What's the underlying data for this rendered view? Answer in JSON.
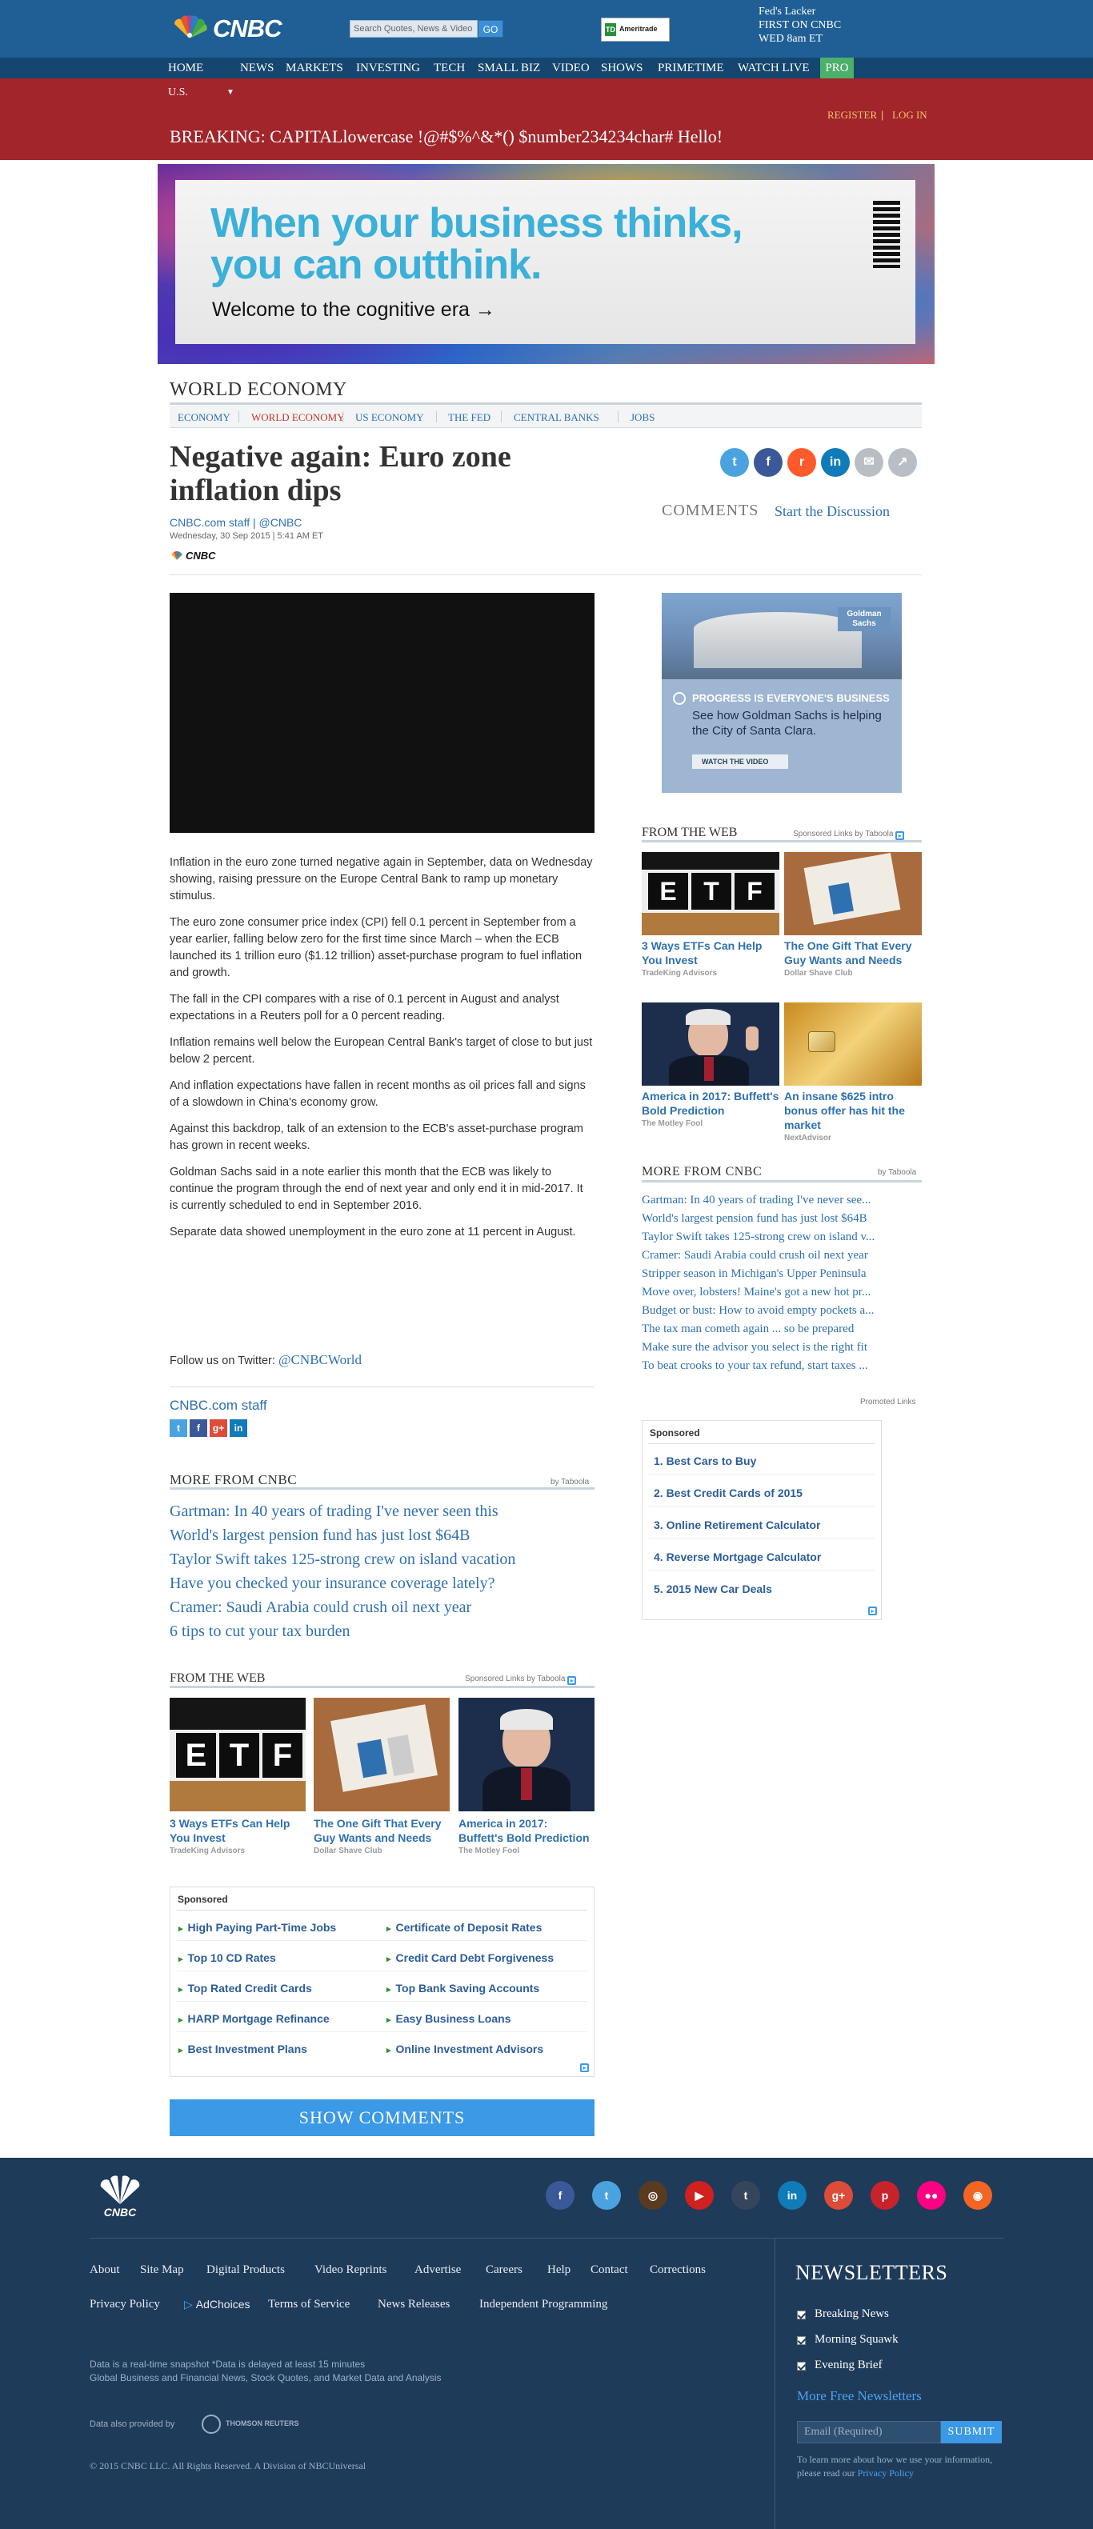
{
  "header": {
    "logo_text": "CNBC",
    "search_placeholder": "Search Quotes, News & Video",
    "search_button": "GO",
    "sponsor_logo": "Ameritrade",
    "promo_lines": [
      "Fed's Lacker",
      "FIRST ON CNBC",
      "WED 8am ET"
    ]
  },
  "nav": {
    "items": [
      "HOME",
      "NEWS",
      "MARKETS",
      "INVESTING",
      "TECH",
      "SMALL BIZ",
      "VIDEO",
      "SHOWS",
      "PRIMETIME",
      "WATCH LIVE"
    ],
    "pro": "PRO"
  },
  "region": {
    "label": "U.S.",
    "register": "REGISTER",
    "login": "LOG IN",
    "separator": "|",
    "breaking": "BREAKING:  CAPITALlowercase !@#$%^&*() $number234234char# Hello!"
  },
  "ad_banner": {
    "headline_1": "When your business thinks,",
    "headline_2": "you can outthink.",
    "subline": "Welcome to the cognitive era →",
    "brand": "IBM"
  },
  "section": {
    "title": "WORLD ECONOMY",
    "tabs": [
      "ECONOMY",
      "WORLD ECONOMY",
      "US ECONOMY",
      "THE FED",
      "CENTRAL BANKS",
      "JOBS"
    ],
    "active_tab": "WORLD ECONOMY"
  },
  "article": {
    "headline": "Negative again: Euro zone inflation dips",
    "byline": "CNBC.com staff | @CNBC",
    "dateline": "Wednesday, 30 Sep 2015 | 5:41 AM ET",
    "source_logo": "CNBC",
    "comments_label": "COMMENTS",
    "comments_link": "Start the Discussion",
    "paragraphs": [
      "Inflation in the euro zone turned negative again in September, data on Wednesday showing, raising pressure on the Europe Central Bank to ramp up monetary stimulus.",
      "The euro zone consumer price index (CPI) fell 0.1 percent in September from a year earlier, falling below zero for the first time since March – when the ECB launched its 1 trillion euro ($1.12 trillion) asset-purchase program to fuel inflation and growth.",
      "The fall in the CPI compares with a rise of 0.1 percent in August and analyst expectations in a Reuters poll for a 0 percent reading.",
      "Inflation remains well below the European Central Bank's target of close to but just below 2 percent.",
      "And inflation expectations have fallen in recent months as oil prices fall and signs of a slowdown in China's economy grow.",
      "Against this backdrop, talk of an extension to the ECB's asset-purchase program has grown in recent weeks.",
      "Goldman Sachs said in a note earlier this month that the ECB was likely to continue the program through the end of next year and only end it in mid-2017. It is currently scheduled to end in September 2016.",
      "Separate data showed unemployment in the euro zone at 11 percent in August."
    ],
    "follow_prefix": "Follow us on Twitter: ",
    "follow_handle": "@CNBCWorld",
    "author": "CNBC.com staff"
  },
  "share_icons": [
    "twitter-icon",
    "facebook-icon",
    "reddit-icon",
    "linkedin-icon",
    "email-icon",
    "share-icon"
  ],
  "more_from_cnbc": {
    "title": "MORE FROM CNBC",
    "by": "by Taboola",
    "items": [
      "Gartman: In 40 years of trading I've never seen this",
      "World's largest pension fund has just lost $64B",
      "Taylor Swift takes 125-strong crew on island vacation",
      "Have you checked your insurance coverage lately?",
      "Cramer: Saudi Arabia could crush oil next year",
      "6 tips to cut your tax burden"
    ]
  },
  "from_the_web": {
    "title": "FROM THE WEB",
    "sponsored": "Sponsored Links by Taboola",
    "cards": [
      {
        "title": "3 Ways ETFs Can Help You Invest",
        "source": "TradeKing Advisors"
      },
      {
        "title": "The One Gift That Every Guy Wants and Needs",
        "source": "Dollar Shave Club"
      },
      {
        "title": "America in 2017: Buffett's Bold Prediction",
        "source": "The Motley Fool"
      }
    ],
    "etf_letters": "E T F"
  },
  "sponsored_box": {
    "title": "Sponsored",
    "links": [
      "High Paying Part-Time Jobs",
      "Certificate of Deposit Rates",
      "Top 10 CD Rates",
      "Credit Card Debt Forgiveness",
      "Top Rated Credit Cards",
      "Top Bank Saving Accounts",
      "HARP Mortgage Refinance",
      "Easy Business Loans",
      "Best Investment Plans",
      "Online Investment Advisors"
    ]
  },
  "show_comments": "SHOW COMMENTS",
  "rail": {
    "gs_ad": {
      "brand": "Goldman Sachs",
      "line1": "PROGRESS IS EVERYONE'S BUSINESS",
      "line2": "See how Goldman Sachs is helping the City of Santa Clara.",
      "cta": "WATCH THE VIDEO"
    },
    "from_the_web": {
      "title": "FROM THE WEB",
      "sponsored": "Sponsored Links by Taboola",
      "cards": [
        {
          "title": "3 Ways ETFs Can Help You Invest",
          "source": "TradeKing Advisors"
        },
        {
          "title": "The One Gift That Every Guy Wants and Needs",
          "source": "Dollar Shave Club"
        },
        {
          "title": "America in 2017: Buffett's Bold Prediction",
          "source": "The Motley Fool"
        },
        {
          "title": "An insane $625 intro bonus offer has hit the market",
          "source": "NextAdvisor"
        }
      ]
    },
    "more_from_cnbc": {
      "title": "MORE FROM CNBC",
      "by": "by Taboola",
      "items": [
        "Gartman: In 40 years of trading I've never see...",
        "World's largest pension fund has just lost $64B",
        "Taylor Swift takes 125-strong crew on island v...",
        "Cramer: Saudi Arabia could crush oil next year",
        "Stripper season in Michigan's Upper Peninsula",
        "Move over, lobsters! Maine's got a new hot pr...",
        "Budget or bust: How to avoid empty pockets a...",
        "The tax man cometh again ... so be prepared",
        "Make sure the advisor you select is the right fit",
        "To beat crooks to your tax refund, start taxes ..."
      ],
      "promoted": "Promoted Links"
    },
    "sponsored_box": {
      "title": "Sponsored",
      "links": [
        "1. Best Cars to Buy",
        "2. Best Credit Cards of 2015",
        "3. Online Retirement Calculator",
        "4. Reverse Mortgage Calculator",
        "5. 2015 New Car Deals"
      ]
    }
  },
  "footer": {
    "logo_text": "CNBC",
    "social_icons": [
      "facebook-icon",
      "twitter-icon",
      "instagram-icon",
      "youtube-icon",
      "tumblr-icon",
      "linkedin-icon",
      "google-plus-icon",
      "pinterest-icon",
      "flickr-icon",
      "rss-icon"
    ],
    "links_row1": [
      "About",
      "Site Map",
      "Digital Products",
      "Video Reprints",
      "Advertise",
      "Careers",
      "Help",
      "Contact",
      "Corrections"
    ],
    "links_row2": [
      "Privacy Policy",
      "AdChoices",
      "Terms of Service",
      "News Releases",
      "Independent Programming"
    ],
    "disclaimer_1": "Data is a real-time snapshot *Data is delayed at least 15 minutes",
    "disclaimer_2": "Global Business and Financial News, Stock Quotes, and Market Data and Analysis",
    "data_provided": "Data also provided by",
    "data_provider": "THOMSON REUTERS",
    "copyright": "© 2015 CNBC LLC. All Rights Reserved. A Division of NBCUniversal",
    "newsletters": {
      "title": "NEWSLETTERS",
      "items": [
        "Breaking News",
        "Morning Squawk",
        "Evening Brief"
      ],
      "more": "More Free Newsletters",
      "email_placeholder": "Email (Required)",
      "submit": "SUBMIT",
      "privacy_text": "To learn more about how we use your information, please read our ",
      "privacy_link": "Privacy Policy"
    }
  },
  "colors": {
    "header_blue": "#1f5f95",
    "nav_blue": "#15466f",
    "breaking_red": "#a1252a",
    "link_blue": "#2f70b0",
    "button_blue": "#3b99e6",
    "pro_green": "#4caf6a",
    "footer_navy": "#1f3b5a"
  }
}
